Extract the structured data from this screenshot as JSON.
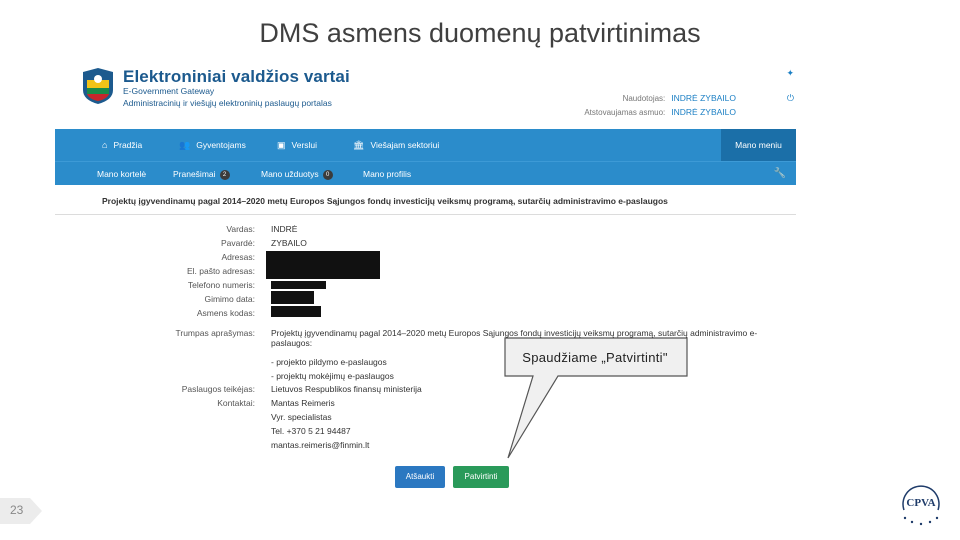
{
  "slide": {
    "title": "DMS asmens duomenų patvirtinimas",
    "page_number": "23",
    "callout": "Spaudžiame „Patvirtinti\"",
    "logo_text": "CPVA"
  },
  "header": {
    "brand_title": "Elektroniniai valdžios vartai",
    "brand_sub1": "E-Government Gateway",
    "brand_sub2": "Administracinių ir viešųjų elektroninių paslaugų portalas",
    "user_label": "Naudotojas:",
    "user_value": "INDRĖ ZYBAILO",
    "rep_label": "Atstovaujamas asmuo:",
    "rep_value": "INDRĖ ZYBAILO"
  },
  "nav": {
    "items": [
      {
        "label": "Pradžia",
        "icon": "home-icon"
      },
      {
        "label": "Gyventojams",
        "icon": "people-icon"
      },
      {
        "label": "Verslui",
        "icon": "briefcase-icon"
      },
      {
        "label": "Viešajam sektoriui",
        "icon": "building-icon"
      }
    ],
    "mine": "Mano meniu"
  },
  "subnav": {
    "items": [
      {
        "label": "Mano kortelė"
      },
      {
        "label": "Pranešimai",
        "badge": "2"
      },
      {
        "label": "Mano užduotys",
        "badge": "0"
      },
      {
        "label": "Mano profilis"
      }
    ]
  },
  "service_title": "Projektų įgyvendinamų pagal 2014–2020 metų Europos Sąjungos fondų investicijų veiksmų programą, sutarčių administravimo e-paslaugos",
  "form": {
    "vardas_label": "Vardas:",
    "vardas_value": "INDRĖ",
    "pavarde_label": "Pavardė:",
    "pavarde_value": "ZYBAILO",
    "adresas_label": "Adresas:",
    "email_label": "El. pašto adresas:",
    "tel_label": "Telefono numeris:",
    "gimimo_label": "Gimimo data:",
    "kodas_label": "Asmens kodas:",
    "trumpas_label": "Trumpas aprašymas:",
    "trumpas_value": "Projektų įgyvendinamų pagal 2014–2020 metų Europos Sąjungos fondų investicijų veiksmų programą, sutarčių administravimo e-paslaugos:",
    "bullet1": "- projekto pildymo e-paslaugos",
    "bullet2": "- projektų mokėjimų e-paslaugos",
    "teikejas_label": "Paslaugos teikėjas:",
    "teikejas_value": "Lietuvos Respublikos finansų ministerija",
    "kontaktai_label": "Kontaktai:",
    "kontaktai_name": "Mantas Reimeris",
    "kontaktai_role": "Vyr. specialistas",
    "kontaktai_tel": "Tel. +370 5 21 94487",
    "kontaktai_email": "mantas.reimeris@finmin.lt"
  },
  "buttons": {
    "back": "Atšaukti",
    "confirm": "Patvirtinti"
  },
  "colors": {
    "nav": "#2b8ccb",
    "nav_dark": "#1b6fa8",
    "brand": "#1c5a8e",
    "confirm": "#2a9a5a",
    "back": "#2b78c1"
  }
}
